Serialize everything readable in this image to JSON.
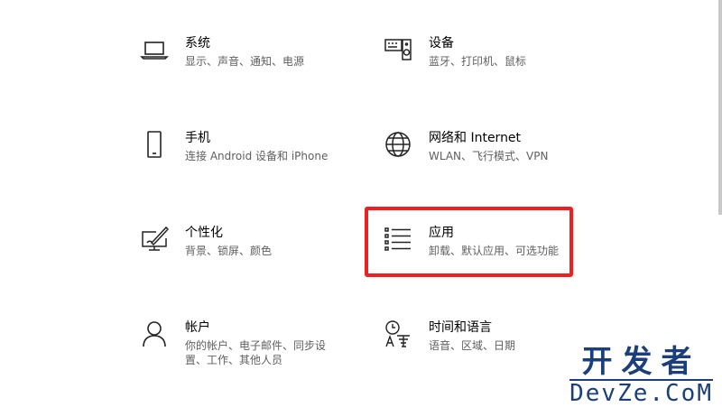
{
  "tiles": {
    "system": {
      "title": "系统",
      "desc": "显示、声音、通知、电源",
      "icon": "laptop-icon"
    },
    "devices": {
      "title": "设备",
      "desc": "蓝牙、打印机、鼠标",
      "icon": "keyboard-speaker-icon"
    },
    "phone": {
      "title": "手机",
      "desc": "连接 Android 设备和 iPhone",
      "icon": "phone-icon"
    },
    "network": {
      "title": "网络和 Internet",
      "desc": "WLAN、飞行模式、VPN",
      "icon": "globe-icon"
    },
    "personal": {
      "title": "个性化",
      "desc": "背景、锁屏、颜色",
      "icon": "paint-brush-icon"
    },
    "apps": {
      "title": "应用",
      "desc": "卸载、默认应用、可选功能",
      "icon": "list-icon"
    },
    "accounts": {
      "title": "帐户",
      "desc": "你的帐户、电子邮件、同步设\n置、工作、其他人员",
      "icon": "person-icon"
    },
    "time": {
      "title": "时间和语言",
      "desc": "语音、区域、日期",
      "icon": "time-language-icon"
    }
  },
  "highlight_color": "#f02020",
  "watermark": {
    "cn": "开发者",
    "en": "DevZe.CoM"
  }
}
